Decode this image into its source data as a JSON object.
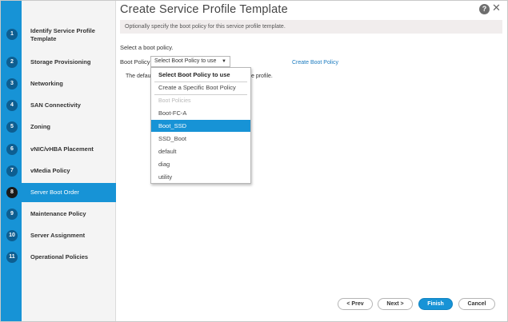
{
  "dialog": {
    "title": "Create Service Profile Template",
    "help_icon": "?",
    "close_icon": "✕"
  },
  "steps": [
    {
      "num": "1",
      "label": "Identify Service Profile Template"
    },
    {
      "num": "2",
      "label": "Storage Provisioning"
    },
    {
      "num": "3",
      "label": "Networking"
    },
    {
      "num": "4",
      "label": "SAN Connectivity"
    },
    {
      "num": "5",
      "label": "Zoning"
    },
    {
      "num": "6",
      "label": "vNIC/vHBA Placement"
    },
    {
      "num": "7",
      "label": "vMedia Policy"
    },
    {
      "num": "8",
      "label": "Server Boot Order"
    },
    {
      "num": "9",
      "label": "Maintenance Policy"
    },
    {
      "num": "10",
      "label": "Server Assignment"
    },
    {
      "num": "11",
      "label": "Operational Policies"
    }
  ],
  "main": {
    "info": "Optionally specify the boot policy for this service profile template.",
    "select_prompt": "Select a boot policy.",
    "boot_policy_label": "Boot Policy:",
    "boot_policy_value": "Select Boot Policy to use",
    "create_link": "Create Boot Policy",
    "behind_text_left": "The defau",
    "behind_text_right": "e profile."
  },
  "dropdown": {
    "header": "Select Boot Policy to use",
    "create_specific": "Create a Specific Boot Policy",
    "group_label": "Boot Policies",
    "options": [
      "Boot-FC-A",
      "Boot_SSD",
      "SSD_Boot",
      "default",
      "diag",
      "utility"
    ],
    "selected": "Boot_SSD"
  },
  "footer": {
    "prev": "< Prev",
    "next": "Next >",
    "finish": "Finish",
    "cancel": "Cancel"
  },
  "colors": {
    "accent": "#1793d6",
    "step_number": "#0d5e91"
  }
}
